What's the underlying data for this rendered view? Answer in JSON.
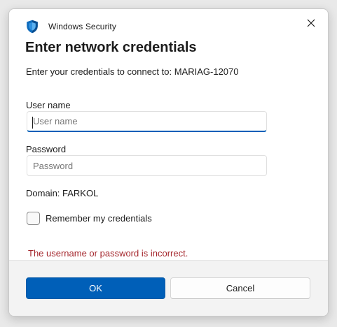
{
  "window": {
    "app_title": "Windows Security",
    "app_icon": "shield-icon",
    "close_icon": "close-icon"
  },
  "dialog": {
    "heading": "Enter network credentials",
    "subtext": "Enter your credentials to connect to: MARIAG-12070"
  },
  "form": {
    "username_label": "User name",
    "username_value": "",
    "username_placeholder": "User name",
    "password_label": "Password",
    "password_value": "",
    "password_placeholder": "Password",
    "domain_text": "Domain: FARKOL",
    "remember_label": "Remember my credentials",
    "remember_checked": false
  },
  "error": {
    "message": "The username or password is incorrect.",
    "color": "#a4262c"
  },
  "buttons": {
    "ok_label": "OK",
    "cancel_label": "Cancel"
  },
  "colors": {
    "accent": "#005fb8",
    "shield_blue": "#0f6cbd"
  }
}
